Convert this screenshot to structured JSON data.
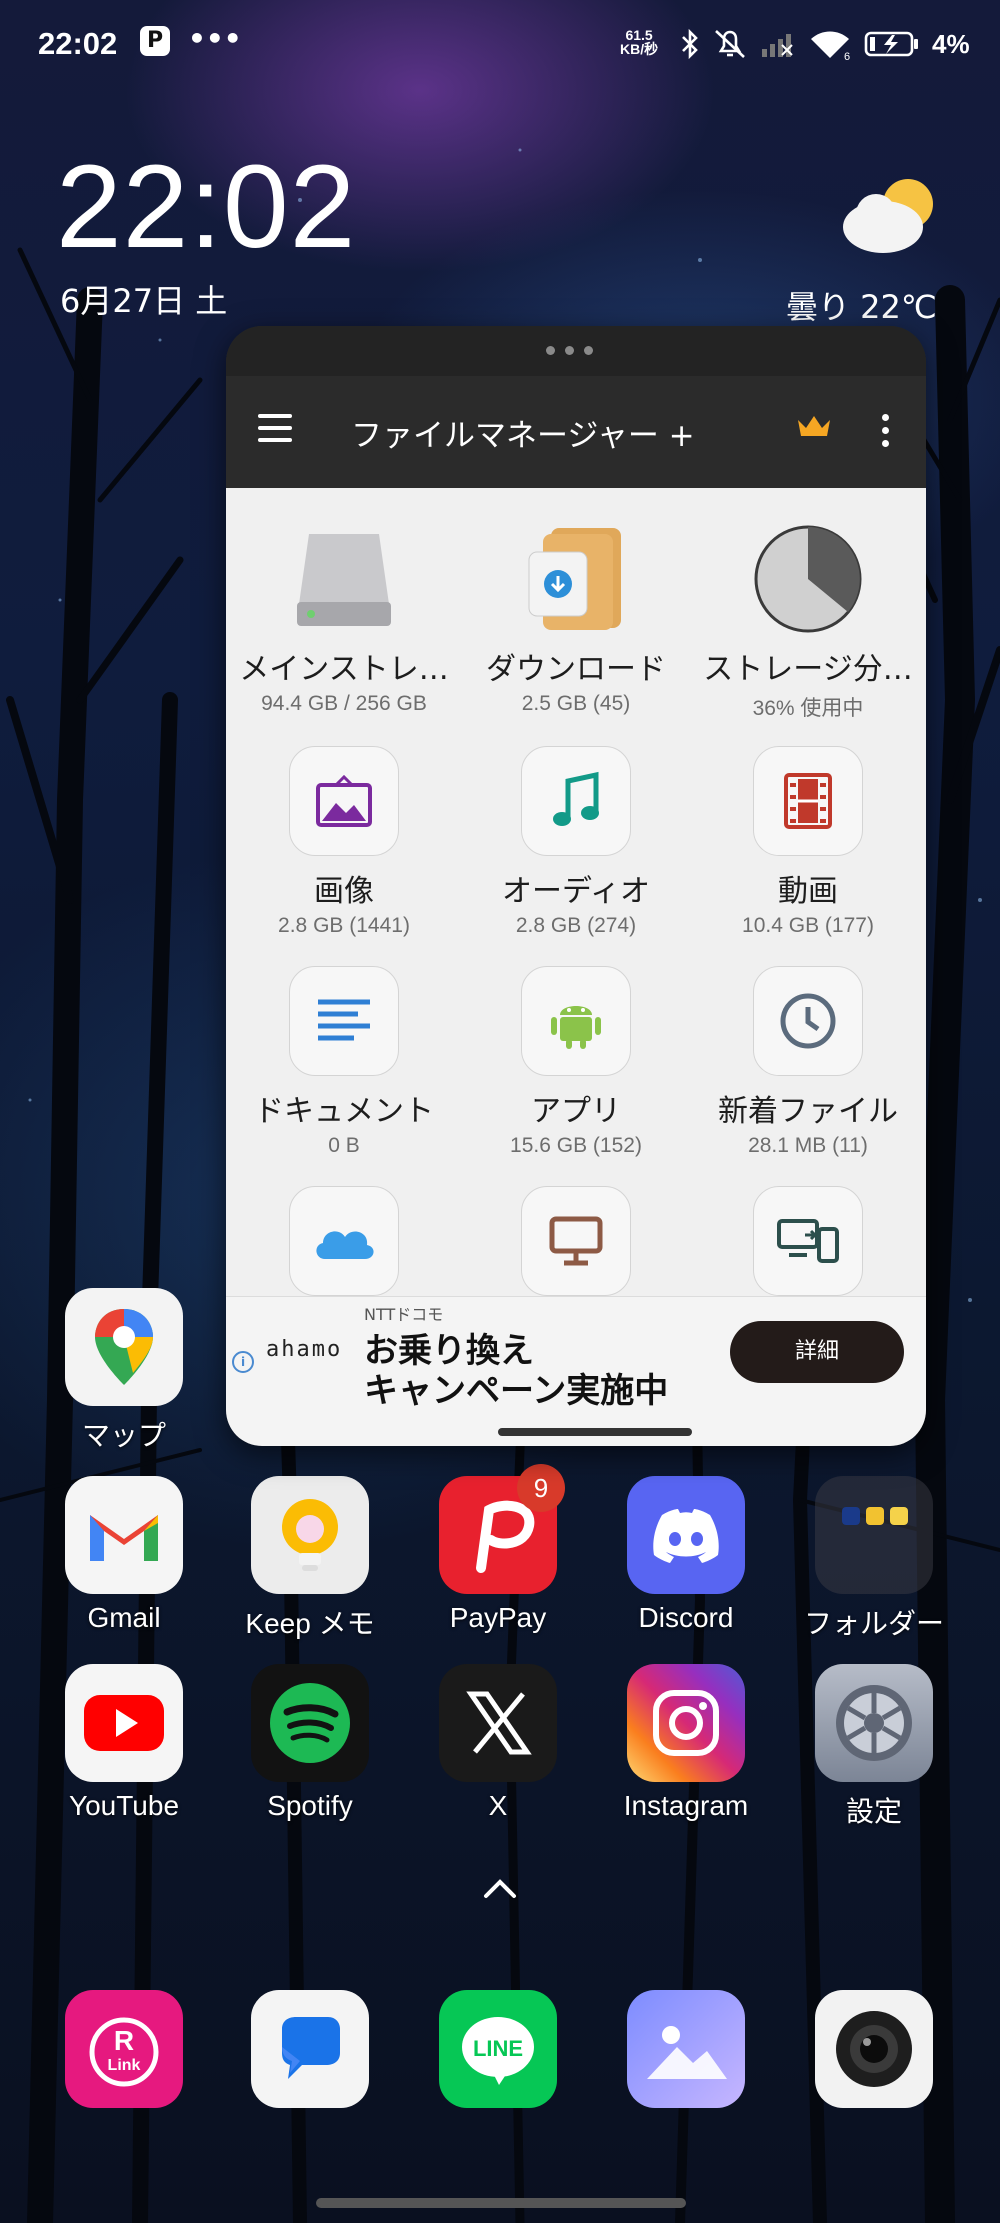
{
  "status_bar": {
    "time": "22:02",
    "notif_icon": "P",
    "more": "•••",
    "net_speed_value": "61.5",
    "net_speed_unit": "KB/秒",
    "battery_pct": "4%",
    "icons": [
      "bluetooth-icon",
      "mute-icon",
      "no-signal-icon",
      "wifi-icon",
      "battery-icon"
    ]
  },
  "clock_widget": {
    "time": "22:02",
    "date": "6月27日 土",
    "weather": "曇り  22℃"
  },
  "popup": {
    "app_title": "ファイルマネージャー +",
    "tiles": [
      {
        "label": "メインストレ…",
        "sub": "94.4 GB / 256 GB",
        "icon": "hard-drive-icon"
      },
      {
        "label": "ダウンロード",
        "sub": "2.5 GB (45)",
        "icon": "download-folder-icon"
      },
      {
        "label": "ストレージ分…",
        "sub": "36% 使用中",
        "icon": "pie-chart-icon"
      },
      {
        "label": "画像",
        "sub": "2.8 GB (1441)",
        "icon": "image-icon"
      },
      {
        "label": "オーディオ",
        "sub": "2.8 GB (274)",
        "icon": "music-note-icon"
      },
      {
        "label": "動画",
        "sub": "10.4 GB (177)",
        "icon": "film-icon"
      },
      {
        "label": "ドキュメント",
        "sub": "0 B",
        "icon": "document-icon"
      },
      {
        "label": "アプリ",
        "sub": "15.6 GB (152)",
        "icon": "android-icon"
      },
      {
        "label": "新着ファイル",
        "sub": "28.1 MB (11)",
        "icon": "clock-icon"
      },
      {
        "label": "",
        "sub": "",
        "icon": "cloud-icon"
      },
      {
        "label": "",
        "sub": "",
        "icon": "monitor-icon"
      },
      {
        "label": "",
        "sub": "",
        "icon": "devices-icon"
      }
    ],
    "ad": {
      "sponsor": "NTTドコモ",
      "brand": "ahamo",
      "line1": "お乗り換え",
      "line2": "キャンペーン実施中",
      "button": "詳細"
    }
  },
  "home_apps": [
    {
      "label": "マップ",
      "icon": "maps-icon"
    },
    {
      "label": "Gmail",
      "icon": "gmail-icon"
    },
    {
      "label": "Keep メモ",
      "icon": "keep-icon"
    },
    {
      "label": "PayPay",
      "icon": "paypay-icon",
      "badge": "9"
    },
    {
      "label": "Discord",
      "icon": "discord-icon"
    },
    {
      "label": "フォルダー",
      "icon": "folder-icon"
    },
    {
      "label": "YouTube",
      "icon": "youtube-icon"
    },
    {
      "label": "Spotify",
      "icon": "spotify-icon"
    },
    {
      "label": "X",
      "icon": "x-icon"
    },
    {
      "label": "Instagram",
      "icon": "instagram-icon"
    },
    {
      "label": "設定",
      "icon": "settings-icon"
    }
  ],
  "dock": [
    {
      "icon": "rakuten-link-icon",
      "text": "Link"
    },
    {
      "icon": "messages-icon"
    },
    {
      "icon": "line-icon",
      "text": "LINE"
    },
    {
      "icon": "gallery-icon"
    },
    {
      "icon": "camera-icon"
    }
  ],
  "colors": {
    "popup_bar": "#2b2b2b",
    "crown": "#f5a623",
    "ad_button": "#231b19",
    "paypay": "#e8212e",
    "discord": "#5865f2",
    "spotify": "#1db954",
    "line": "#06c755"
  }
}
